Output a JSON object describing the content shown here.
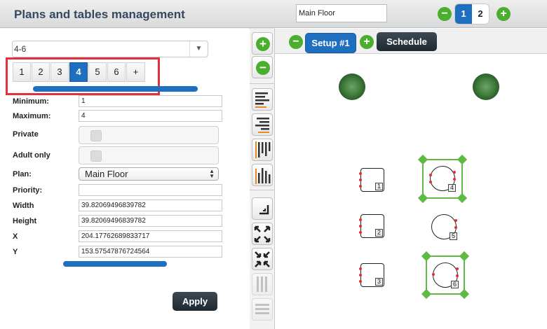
{
  "left_panel": {
    "title": "Plans and tables management",
    "range_select": {
      "value": "4-6"
    },
    "capacity_tabs": [
      {
        "label": "1",
        "active": false
      },
      {
        "label": "2",
        "active": false
      },
      {
        "label": "3",
        "active": false
      },
      {
        "label": "4",
        "active": true
      },
      {
        "label": "5",
        "active": false
      },
      {
        "label": "6",
        "active": false
      },
      {
        "label": "+",
        "active": false
      }
    ],
    "form": {
      "minimum": {
        "label": "Minimum:",
        "value": "1"
      },
      "maximum": {
        "label": "Maximum:",
        "value": "4"
      },
      "private": {
        "label": "Private"
      },
      "adult_only": {
        "label": "Adult only"
      },
      "plan": {
        "label": "Plan:",
        "value": "Main Floor"
      },
      "priority": {
        "label": "Priority:",
        "value": ""
      },
      "width": {
        "label": "Width",
        "value": "39.82069496839782"
      },
      "height": {
        "label": "Height",
        "value": "39.82069496839782"
      },
      "x": {
        "label": "X",
        "value": "204.17762689833717"
      },
      "y": {
        "label": "Y",
        "value": "153.57547876724564"
      }
    },
    "apply_label": "Apply"
  },
  "toolbar": {
    "add": "+",
    "remove": "−",
    "icons": [
      "align-left-icon",
      "align-right-icon",
      "align-top-icon",
      "align-bottom-icon",
      "resize-corner-icon",
      "expand-icon",
      "collapse-icon",
      "distribute-vertical-icon",
      "distribute-horizontal-icon"
    ]
  },
  "right_panel": {
    "floor_name": "Main Floor",
    "floor_tabs": [
      {
        "label": "1",
        "active": true
      },
      {
        "label": "2",
        "active": false
      }
    ],
    "add_floor": "+",
    "remove_floor": "−",
    "setup_label": "Setup #1",
    "add_setup": "+",
    "remove_setup": "−",
    "schedule_label": "Schedule",
    "tables": [
      {
        "number": "1",
        "shape": "square",
        "selected": false
      },
      {
        "number": "2",
        "shape": "square",
        "selected": false
      },
      {
        "number": "3",
        "shape": "square",
        "selected": false
      },
      {
        "number": "4",
        "shape": "round",
        "selected": true
      },
      {
        "number": "5",
        "shape": "round",
        "selected": false
      },
      {
        "number": "6",
        "shape": "round",
        "selected": true
      }
    ]
  },
  "colors": {
    "accent": "#1f6fc1",
    "green": "#4cae2f",
    "highlight": "#e2303e",
    "dark_button": "#2a3540"
  }
}
